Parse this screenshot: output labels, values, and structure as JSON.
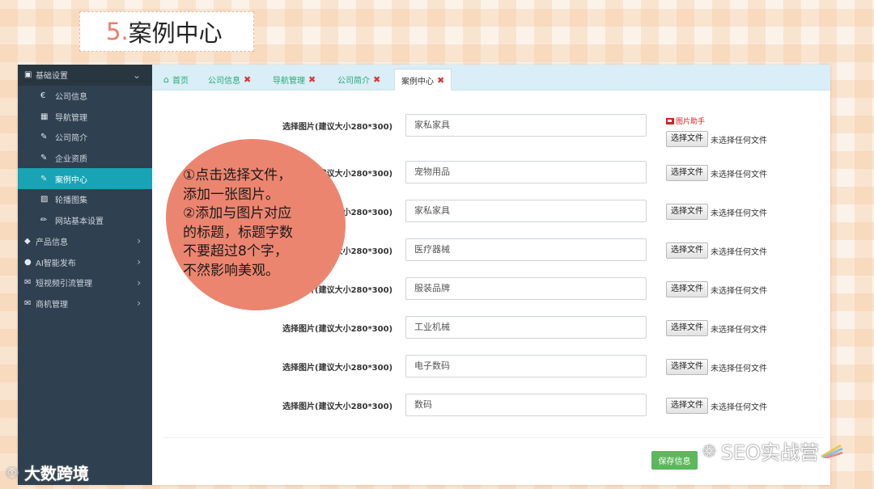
{
  "slide": {
    "title_num": "5.",
    "title_text": "案例中心"
  },
  "sidebar": {
    "header": {
      "label": "基础设置"
    },
    "sub_items": [
      {
        "label": "公司信息",
        "icon": "euro-icon"
      },
      {
        "label": "导航管理",
        "icon": "grid-icon"
      },
      {
        "label": "公司简介",
        "icon": "edit-icon"
      },
      {
        "label": "企业资质",
        "icon": "edit-icon"
      },
      {
        "label": "案例中心",
        "icon": "edit-icon"
      },
      {
        "label": "轮播图集",
        "icon": "image-icon"
      },
      {
        "label": "网站基本设置",
        "icon": "pencil-icon"
      }
    ],
    "groups": [
      {
        "label": "产品信息"
      },
      {
        "label": "AI智能发布"
      },
      {
        "label": "短视频引流管理"
      },
      {
        "label": "商机管理"
      }
    ]
  },
  "tabs": [
    {
      "label": "首页"
    },
    {
      "label": "公司信息"
    },
    {
      "label": "导航管理"
    },
    {
      "label": "公司简介"
    },
    {
      "label": "案例中心"
    }
  ],
  "form": {
    "label": "选择图片(建议大小280*300)",
    "file_button": "选择文件",
    "file_status": "未选择任何文件",
    "helper": "图片助手",
    "rows": [
      {
        "value": "家私家具"
      },
      {
        "value": "宠物用品"
      },
      {
        "value": "家私家具"
      },
      {
        "value": "医疗器械"
      },
      {
        "value": "服装品牌"
      },
      {
        "value": "工业机械"
      },
      {
        "value": "电子数码"
      },
      {
        "value": "数码"
      }
    ],
    "save": "保存信息"
  },
  "annotation": [
    "①点击选择文件，",
    "添加一张图片。",
    "②添加与图片对应",
    "的标题，标题字数",
    "不要超过8个字，",
    "不然影响美观。"
  ],
  "watermark_left": "大数跨境",
  "watermark_right": "SEO实战营",
  "colors": {
    "sidebar_bg": "#2f4050",
    "active_bg": "#18a4b4",
    "tab_text": "#2aa876",
    "save_bg": "#5cb85c",
    "annotation_bg": "#ec8570"
  }
}
